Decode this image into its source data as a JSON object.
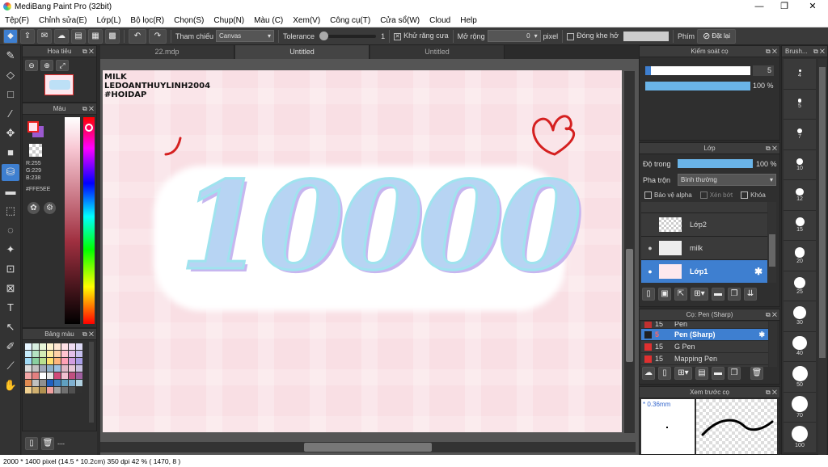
{
  "app": {
    "title": "MediBang Paint Pro (32bit)",
    "min": "—",
    "max": "❐",
    "close": "✕"
  },
  "menu": [
    "Tệp(F)",
    "Chỉnh sửa(E)",
    "Lớp(L)",
    "Bộ lọc(R)",
    "Chọn(S)",
    "Chụp(N)",
    "Màu (C)",
    "Xem(V)",
    "Công cụ(T)",
    "Cửa sổ(W)",
    "Cloud",
    "Help"
  ],
  "toolbar": {
    "ref_label": "Tham chiếu",
    "ref_value": "Canvas",
    "tolerance_label": "Tolerance",
    "tolerance_value": "1",
    "antialias_label": "Khử răng cưa",
    "expand_label": "Mở rộng",
    "expand_value": "0",
    "pixel_label": "pixel",
    "close_gap_label": "Đóng khe hở",
    "key_label": "Phím",
    "reset_label": "Đặt lại"
  },
  "navigator": {
    "title": "Hoa tiêu"
  },
  "color": {
    "title": "Màu",
    "r": "R:255",
    "g": "G:229",
    "b": "B:238",
    "hex": "#FFE5EE",
    "main": "#ffe5ee",
    "sub": "#9b59d0"
  },
  "palette": {
    "title": "Bảng màu",
    "label": "---",
    "colors": [
      "#e6f5ff",
      "#d8efe0",
      "#e8f6d8",
      "#fff4cf",
      "#ffe7d2",
      "#ffe0e6",
      "#f0dcf2",
      "#ddd9f5",
      "#c6ecfb",
      "#b5e3c2",
      "#d4ee b6",
      "#ffec9f",
      "#ffd1a8",
      "#ffc4d1",
      "#e3bfe8",
      "#c6bfee",
      "#9fd9f5",
      "#89d0a0",
      "#b9e08f",
      "#ffdf6e",
      "#ffb57c",
      "#ffa0b6",
      "#d29ee0",
      "#a89de6",
      "#dcdcdc",
      "#c2c2c2",
      "#a0a8b8",
      "#8fb0c8",
      "#9cc0e0",
      "#e0b8c8",
      "#e8c8d8",
      "#c8c0e0",
      "#f2a6a6",
      "#e48080",
      "#ffffff",
      "#e8e8e8",
      "#d04a7a",
      "#f2c0d0",
      "#c05080",
      "#a060a0",
      "#e08a50",
      "#c0c0c0",
      "#909090",
      "#2060c0",
      "#4080c0",
      "#60a0c0",
      "#80b0d0",
      "#b0d0e0",
      "#f0d090",
      "#d0b070",
      "#b09050",
      "#f0a0a0",
      "#a0a0a0",
      "#707070",
      "#505050",
      "#303030"
    ]
  },
  "tabs": [
    "22.mdp",
    "Untitled",
    "Untitled"
  ],
  "canvas": {
    "text1": "MILK",
    "text2": "LEDOANTHUYLINH2004",
    "text3": "#HOIDAP",
    "big": "10000"
  },
  "brush_control": {
    "title": "Kiểm soát cọ",
    "size": "5",
    "opacity": "100 %",
    "size_fill": 0.05,
    "opacity_fill": 1.0
  },
  "layer": {
    "title": "Lớp",
    "opacity_label": "Độ trong",
    "opacity_value": "100 %",
    "blend_label": "Pha trộn",
    "blend_value": "Bình thường",
    "protect_alpha": "Bảo vệ alpha",
    "clip": "Xén bớt",
    "lock": "Khóa",
    "items": [
      {
        "name": "Lớp2",
        "eye": false
      },
      {
        "name": "milk",
        "eye": true
      },
      {
        "name": "Lớp1",
        "eye": true
      }
    ]
  },
  "brushes": {
    "title": "Cọ: Pen (Sharp)",
    "items": [
      {
        "size": "15",
        "name": "Pen",
        "color": "#c03030"
      },
      {
        "size": "5",
        "name": "Pen (Sharp)",
        "color": "#202020"
      },
      {
        "size": "15",
        "name": "G Pen",
        "color": "#e03030"
      },
      {
        "size": "15",
        "name": "Mapping Pen",
        "color": "#e03030"
      }
    ]
  },
  "preview": {
    "title": "Xem trước cọ",
    "size_label": "0.36mm"
  },
  "brush_sizes": {
    "title": "Brush...",
    "sizes": [
      "4",
      "5",
      "7",
      "10",
      "12",
      "15",
      "20",
      "25",
      "30",
      "40",
      "50",
      "70",
      "100"
    ]
  },
  "status": {
    "text": "2000 * 1400 pixel   (14.5 * 10.2cm)   350 dpi   42 %   ( 1470, 8 )"
  }
}
